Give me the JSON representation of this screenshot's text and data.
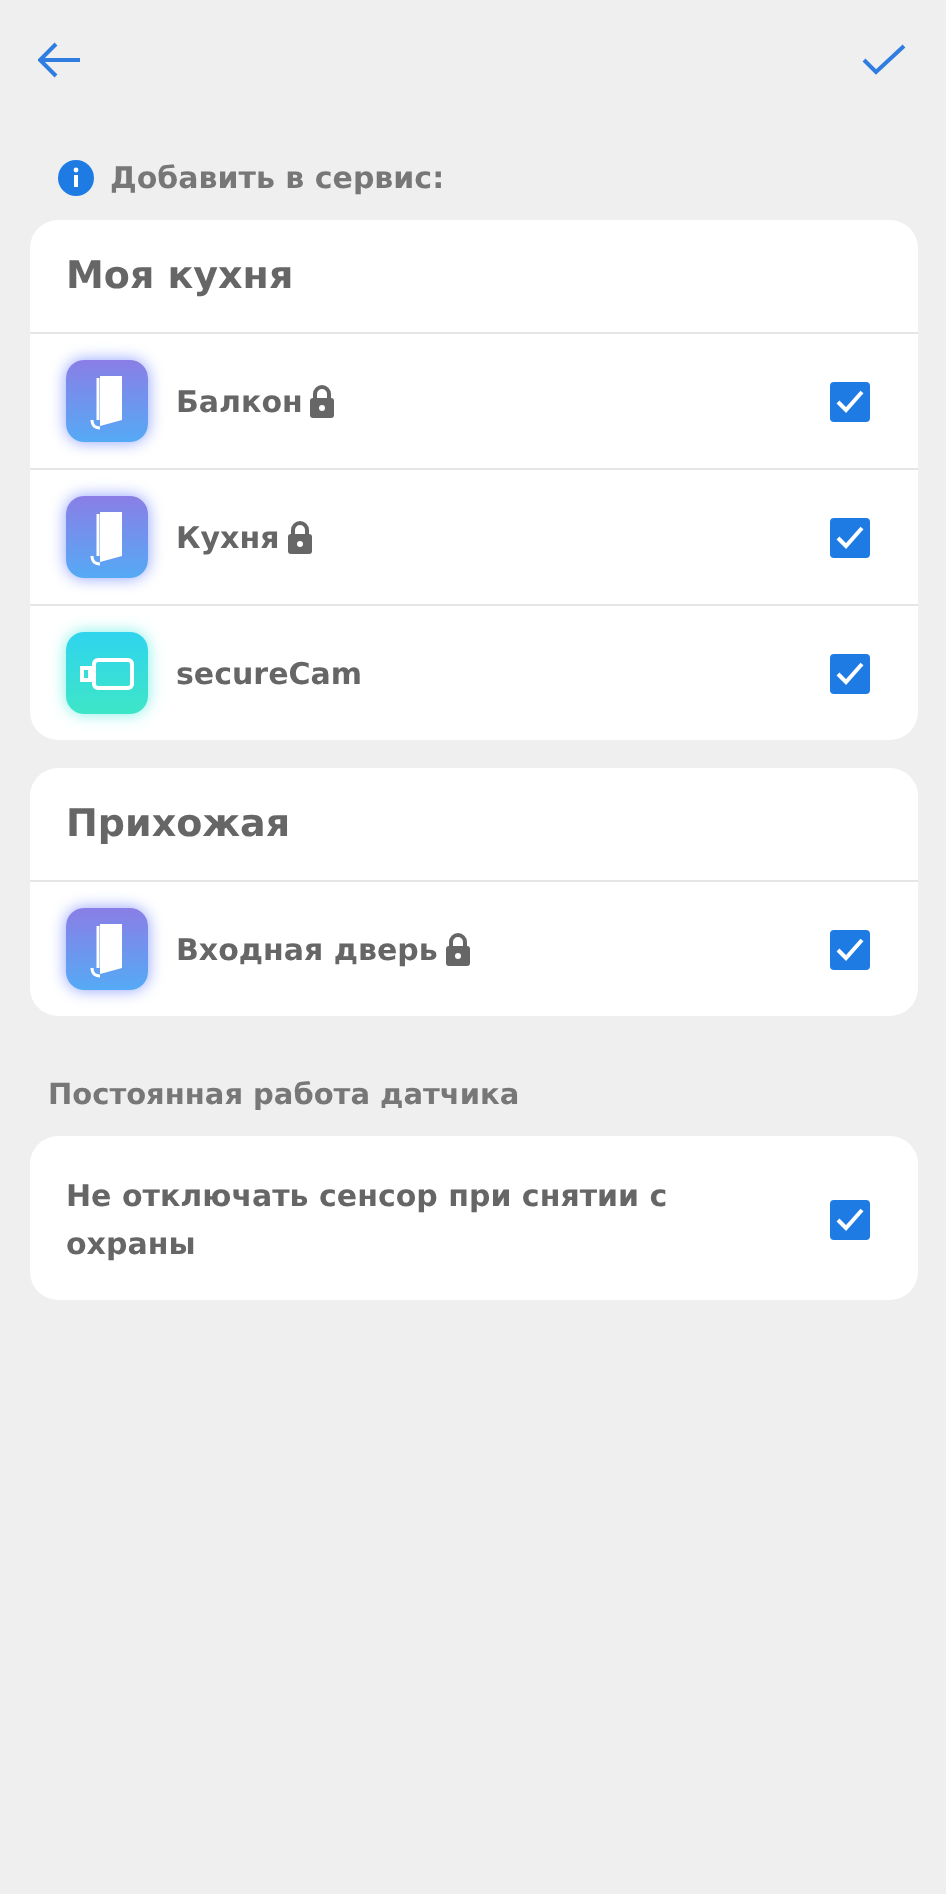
{
  "header": {
    "confirm": true
  },
  "info": {
    "text": "Добавить в сервис:"
  },
  "groups": [
    {
      "title": "Моя кухня",
      "devices": [
        {
          "name": "Балкон",
          "kind": "door",
          "locked": true,
          "checked": true
        },
        {
          "name": "Кухня",
          "kind": "door",
          "locked": true,
          "checked": true
        },
        {
          "name": "secureCam",
          "kind": "camera",
          "locked": false,
          "checked": true
        }
      ]
    },
    {
      "title": "Прихожая",
      "devices": [
        {
          "name": "Входная дверь",
          "kind": "door",
          "locked": true,
          "checked": true
        }
      ]
    }
  ],
  "sensor": {
    "title": "Постоянная работа датчика",
    "option": {
      "label": "Не отключать сенсор при снятии с охраны",
      "checked": true
    }
  }
}
